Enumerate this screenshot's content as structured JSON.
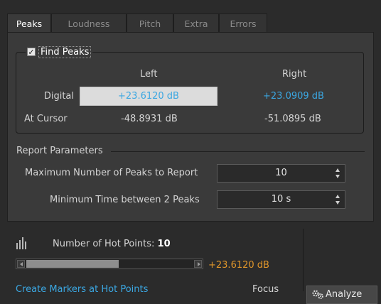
{
  "tabs": [
    "Peaks",
    "Loudness",
    "Pitch",
    "Extra",
    "Errors"
  ],
  "find_peaks": {
    "label": "Find Peaks",
    "checked": true,
    "col_left": "Left",
    "col_right": "Right",
    "rows": [
      {
        "label": "Digital",
        "left": "+23.6120 dB",
        "right": "+23.0909 dB"
      },
      {
        "label": "At Cursor",
        "left": "-48.8931 dB",
        "right": "-51.0895 dB"
      }
    ]
  },
  "report": {
    "title": "Report Parameters",
    "max_peaks_label": "Maximum Number of Peaks to Report",
    "max_peaks_value": "10",
    "min_time_label": "Minimum Time between 2 Peaks",
    "min_time_value": "10 s"
  },
  "hot_points": {
    "label": "Number of Hot Points:",
    "count": "10",
    "current_value": "+23.6120 dB",
    "create_markers_link": "Create Markers at Hot Points",
    "focus_label": "Focus"
  },
  "analyze_button": "Analyze",
  "colors": {
    "accent_blue": "#3ba7e2",
    "accent_orange": "#e0962a"
  },
  "icons": [
    "checkmark-icon",
    "hot-points-icon",
    "analyze-gears-icon",
    "scroll-left-icon",
    "scroll-right-icon",
    "spin-arrows-icon"
  ]
}
